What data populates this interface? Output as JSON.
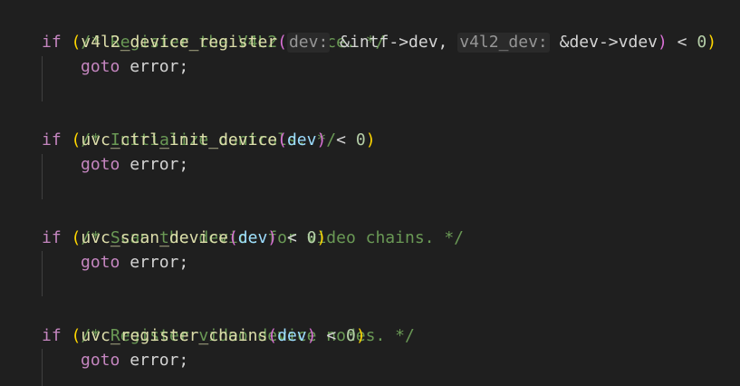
{
  "code": {
    "l1": {
      "comment": "/* Register the V4L2 device. */"
    },
    "l2": {
      "kw": "if",
      "sp": " ",
      "p_open": "(",
      "fn": "v4l2_device_register",
      "inner_open": "(",
      "hint1": "dev:",
      "arg1": "&intf->dev",
      "comma": ", ",
      "hint2": "v4l2_dev:",
      "arg2": "&dev->vdev",
      "inner_close": ")",
      "cmp": " < ",
      "num": "0",
      "p_close": ")"
    },
    "l3": {
      "kw": "goto",
      "rest": " error;"
    },
    "l4": {
      "comment": "/* Initialize controls. */"
    },
    "l5": {
      "kw": "if",
      "sp": " ",
      "p_open": "(",
      "fn": "uvc_ctrl_init_device",
      "inner_open": "(",
      "arg": "dev",
      "inner_close": ")",
      "cmp": " < ",
      "num": "0",
      "p_close": ")"
    },
    "l6": {
      "kw": "goto",
      "rest": " error;"
    },
    "l7": {
      "comment": "/* Scan the device for video chains. */"
    },
    "l8": {
      "kw": "if",
      "sp": " ",
      "p_open": "(",
      "fn": "uvc_scan_device",
      "inner_open": "(",
      "arg": "dev",
      "inner_close": ")",
      "cmp": " < ",
      "num": "0",
      "p_close": ")"
    },
    "l9": {
      "kw": "goto",
      "rest": " error;"
    },
    "l10": {
      "comment": "/* Register video device nodes. */"
    },
    "l11": {
      "kw": "if",
      "sp": " ",
      "p_open": "(",
      "fn": "uvc_register_chains",
      "inner_open": "(",
      "arg": "dev",
      "inner_close": ")",
      "cmp": " < ",
      "num": "0",
      "p_close": ")"
    },
    "l12": {
      "kw": "goto",
      "rest": " error;"
    }
  },
  "colors": {
    "background": "#1f1f1f",
    "comment": "#6a9955",
    "keyword": "#c586c0",
    "function": "#dcdcaa",
    "identifier": "#9cdcfe",
    "number": "#b5cea8",
    "bracket_outer": "#ffd700",
    "bracket_inner": "#da70d6",
    "inlay_hint": "#969696"
  }
}
